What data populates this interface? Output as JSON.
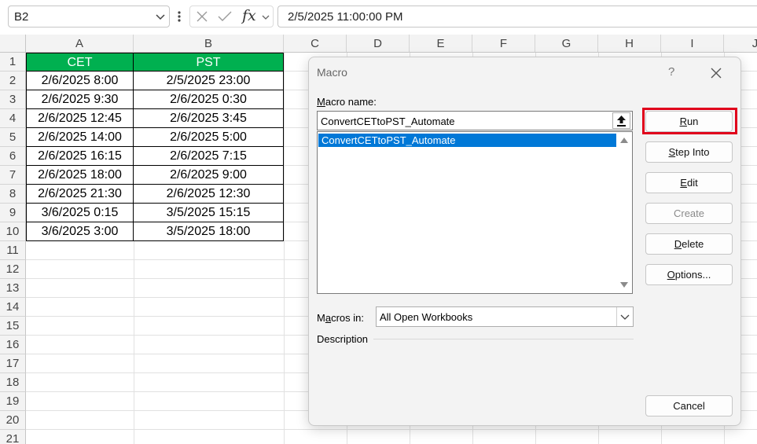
{
  "formula_bar": {
    "name_box": "B2",
    "fx_label": "fx",
    "formula_value": "2/5/2025  11:00:00 PM"
  },
  "grid": {
    "columns": [
      "A",
      "B",
      "C",
      "D",
      "E",
      "F",
      "G",
      "H",
      "I",
      "J"
    ],
    "rows": [
      "1",
      "2",
      "3",
      "4",
      "5",
      "6",
      "7",
      "8",
      "9",
      "10",
      "11",
      "12",
      "13",
      "14",
      "15",
      "16",
      "17",
      "18",
      "19",
      "20",
      "21"
    ]
  },
  "table": {
    "headers": [
      "CET",
      "PST"
    ],
    "rows": [
      [
        "2/6/2025 8:00",
        "2/5/2025 23:00"
      ],
      [
        "2/6/2025 9:30",
        "2/6/2025 0:30"
      ],
      [
        "2/6/2025 12:45",
        "2/6/2025 3:45"
      ],
      [
        "2/6/2025 14:00",
        "2/6/2025 5:00"
      ],
      [
        "2/6/2025 16:15",
        "2/6/2025 7:15"
      ],
      [
        "2/6/2025 18:00",
        "2/6/2025 9:00"
      ],
      [
        "2/6/2025 21:30",
        "2/6/2025 12:30"
      ],
      [
        "3/6/2025 0:15",
        "3/5/2025 15:15"
      ],
      [
        "3/6/2025 3:00",
        "3/5/2025 18:00"
      ]
    ],
    "header_color": "#00b050"
  },
  "dialog": {
    "title": "Macro",
    "help": "?",
    "macro_name_label_u": "M",
    "macro_name_label_rest": "acro name:",
    "macro_name_value": "ConvertCETtoPST_Automate",
    "macro_list": [
      "ConvertCETtoPST_Automate"
    ],
    "buttons": {
      "run_u": "R",
      "run_rest": "un",
      "step_u": "S",
      "step_rest": "tep Into",
      "edit_u": "E",
      "edit_rest": "dit",
      "create": "Create",
      "delete_u": "D",
      "delete_rest": "elete",
      "options_u": "O",
      "options_rest": "ptions...",
      "cancel": "Cancel"
    },
    "macros_in_label_pre": "M",
    "macros_in_label_u": "a",
    "macros_in_label_rest": "cros in:",
    "macros_in_value": "All Open Workbooks",
    "description_label": "Description",
    "highlight_color": "#e0001b",
    "selection_color": "#0078d7"
  }
}
